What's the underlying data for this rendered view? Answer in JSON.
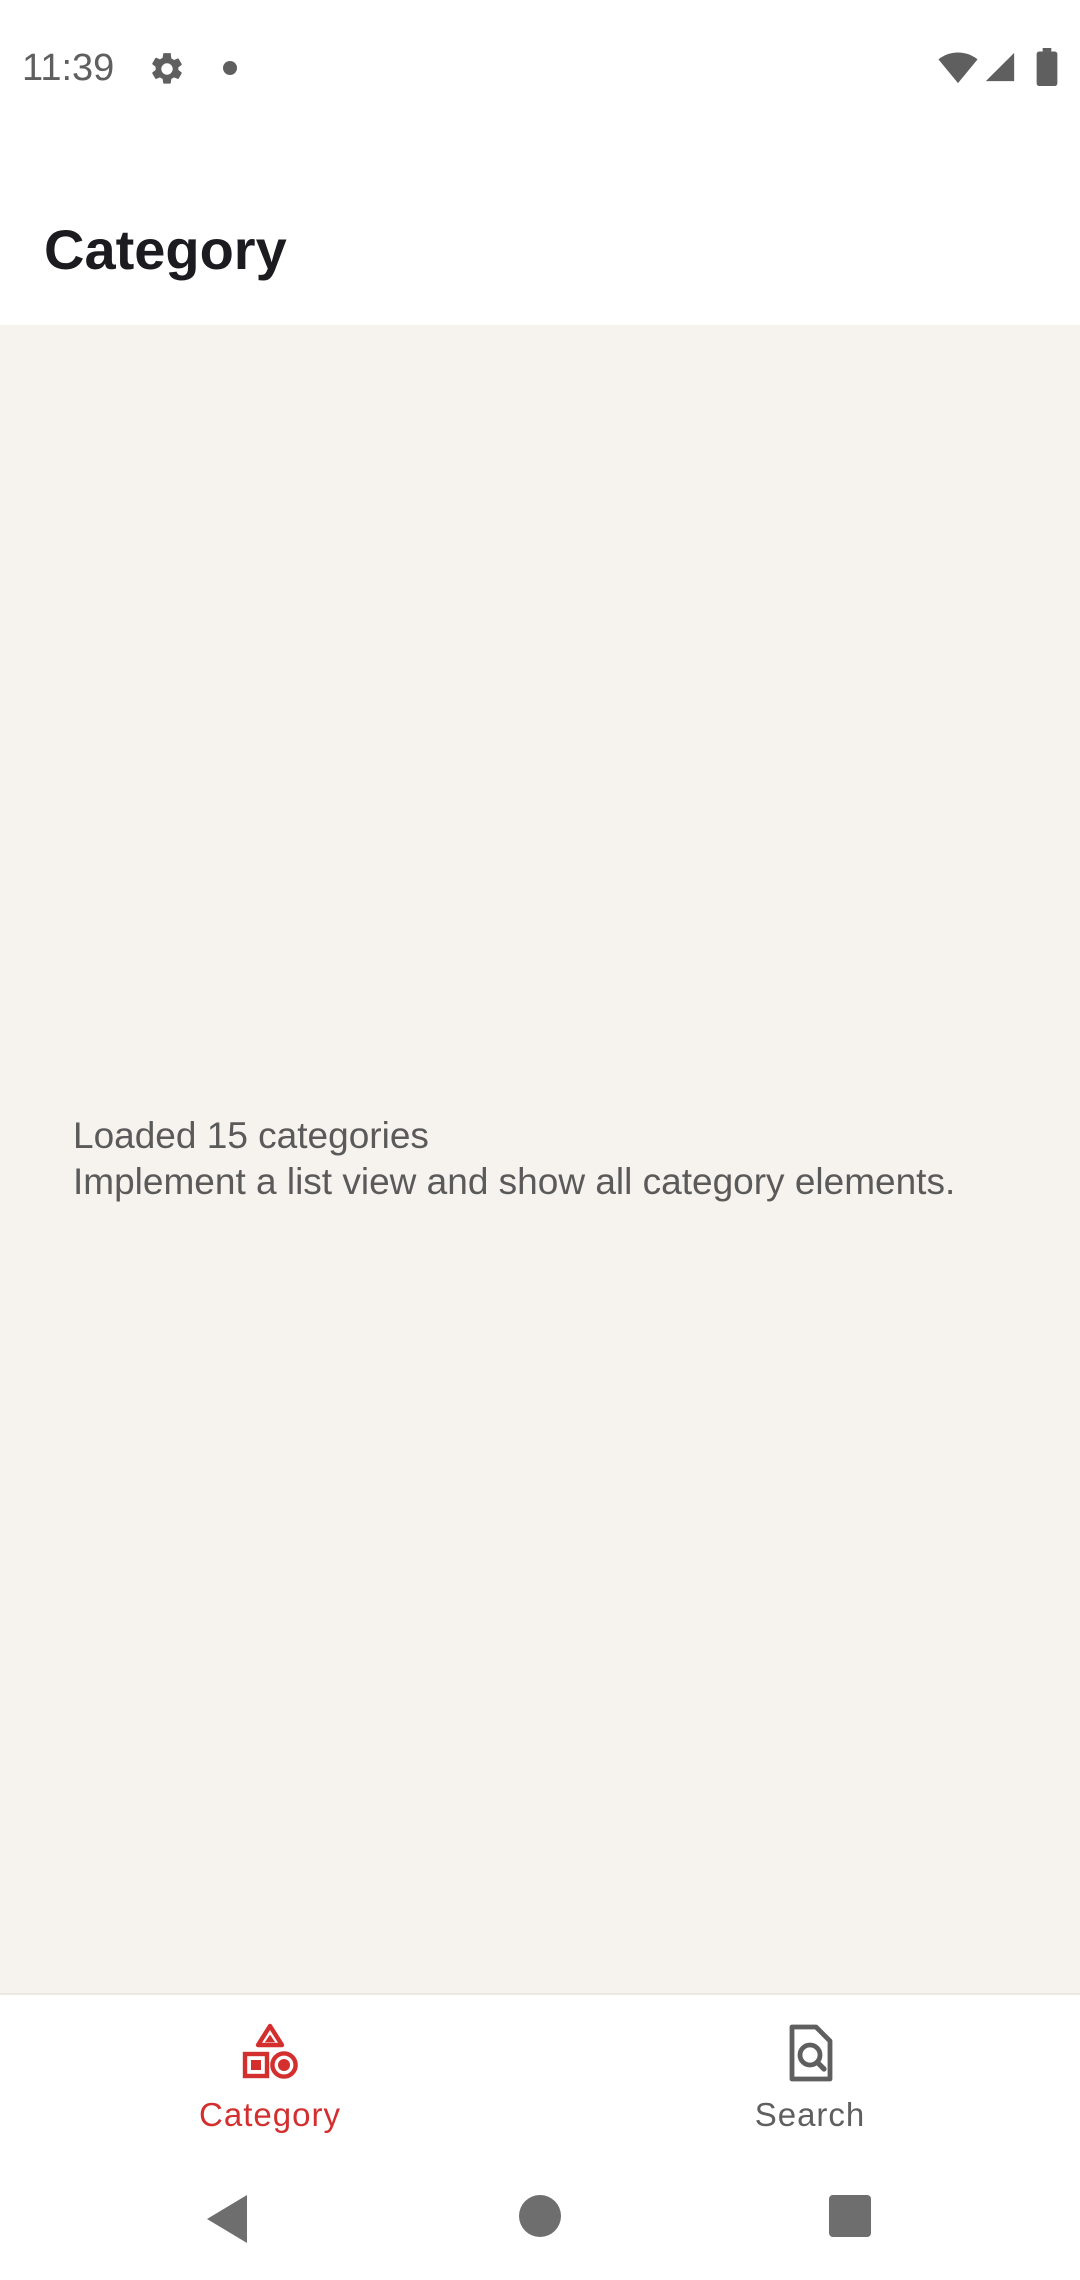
{
  "status_bar": {
    "time": "11:39",
    "icons": [
      "gear-icon",
      "notification-dot-icon",
      "wifi-icon",
      "cell-signal-icon",
      "battery-icon"
    ]
  },
  "app_bar": {
    "title": "Category"
  },
  "content": {
    "line1": "Loaded 15 categories",
    "line2": "Implement a list view and show all category elements."
  },
  "bottom_nav": {
    "items": [
      {
        "label": "Category",
        "icon": "shapes-icon",
        "selected": true,
        "color": "#d32f2f"
      },
      {
        "label": "Search",
        "icon": "document-search-icon",
        "selected": false,
        "color": "#5f5f5f"
      }
    ]
  },
  "colors": {
    "accent": "#d32f2f",
    "content_background": "#f6f3ee",
    "text_secondary": "#5a5a5a"
  }
}
